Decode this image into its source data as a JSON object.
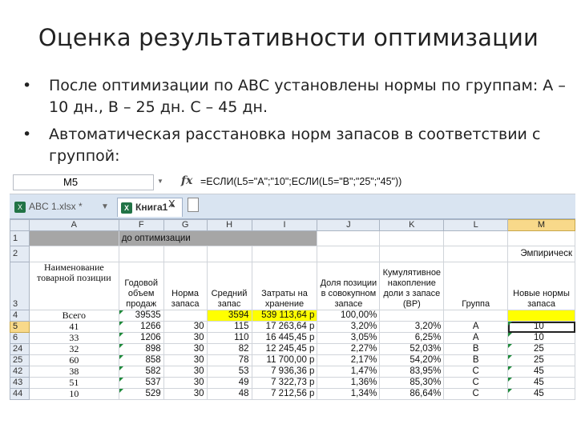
{
  "slide": {
    "title": "Оценка результативности оптимизации",
    "bullets": [
      "После оптимизации по АВС установлены нормы по группам: А – 10 дн., В – 25 дн. С – 45 дн.",
      "Автоматическая расстановка норм запасов в соответствии с группой:"
    ]
  },
  "excel": {
    "name_box": "M5",
    "fx_icon": "fx-icon",
    "formula": "=ЕСЛИ(L5=\"A\";\"10\";ЕСЛИ(L5=\"B\";\"25\";\"45\"))",
    "tabs": [
      {
        "label": "ABC 1.xlsx *",
        "active": false
      },
      {
        "label": "Книга1 *",
        "active": true
      }
    ],
    "tab_close": "X",
    "columns": [
      "A",
      "F",
      "G",
      "H",
      "I",
      "J",
      "K",
      "L",
      "M"
    ],
    "selected_column": "M",
    "row_numbers": [
      "1",
      "2",
      "3",
      "4",
      "5",
      "6",
      "24",
      "25",
      "42",
      "43",
      "44"
    ],
    "selected_row": "5",
    "row1_label": "до оптимизации",
    "row2_right_label": "Эмпирическ",
    "headers": {
      "A": "Наименование товарной позиции",
      "F": "Годовой объем продаж",
      "G": "Норма запаса",
      "H": "Средний запас",
      "I": "Затраты на хранение",
      "J": "Доля позиции в совокупном запасе",
      "K": "Кумулятивное накопление доли з запасе (ВР)",
      "L": "Группа",
      "M": "Новые нормы запаса"
    },
    "total_row": {
      "A": "Всего",
      "F": "39535",
      "G": "",
      "H": "3594",
      "I": "539 113,64 р",
      "J": "100,00%",
      "K": "",
      "L": "",
      "M": ""
    },
    "rows": [
      {
        "A": "41",
        "F": "1266",
        "G": "30",
        "H": "115",
        "I": "17 263,64 р",
        "J": "3,20%",
        "K": "3,20%",
        "L": "A",
        "M": "10"
      },
      {
        "A": "33",
        "F": "1206",
        "G": "30",
        "H": "110",
        "I": "16 445,45 р",
        "J": "3,05%",
        "K": "6,25%",
        "L": "A",
        "M": "10"
      },
      {
        "A": "32",
        "F": "898",
        "G": "30",
        "H": "82",
        "I": "12 245,45 р",
        "J": "2,27%",
        "K": "52,03%",
        "L": "B",
        "M": "25"
      },
      {
        "A": "60",
        "F": "858",
        "G": "30",
        "H": "78",
        "I": "11 700,00 р",
        "J": "2,17%",
        "K": "54,20%",
        "L": "B",
        "M": "25"
      },
      {
        "A": "38",
        "F": "582",
        "G": "30",
        "H": "53",
        "I": "7 936,36 р",
        "J": "1,47%",
        "K": "83,95%",
        "L": "C",
        "M": "45"
      },
      {
        "A": "51",
        "F": "537",
        "G": "30",
        "H": "49",
        "I": "7 322,73 р",
        "J": "1,36%",
        "K": "85,30%",
        "L": "C",
        "M": "45"
      },
      {
        "A": "10",
        "F": "529",
        "G": "30",
        "H": "48",
        "I": "7 212,56 р",
        "J": "1,34%",
        "K": "86,64%",
        "L": "C",
        "M": "45"
      }
    ]
  }
}
